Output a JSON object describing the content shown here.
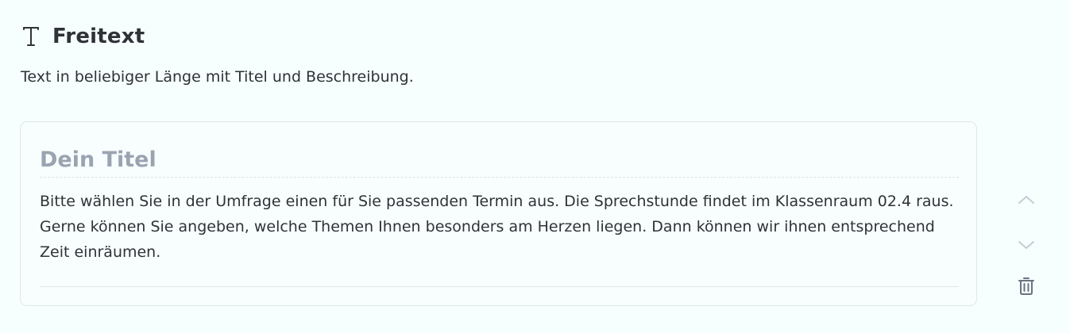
{
  "header": {
    "icon": "text-type-icon",
    "title": "Freitext",
    "description": "Text in beliebiger Länge mit Titel und Beschreibung."
  },
  "card": {
    "title_placeholder": "Dein Titel",
    "title_value": "",
    "body_value": "Bitte wählen Sie in der Umfrage einen für Sie passenden Termin aus. Die Sprechstunde findet im Klassenraum 02.4 raus.\nGerne können Sie angeben, welche Themen Ihnen besonders am Herzen liegen. Dann können wir ihnen entsprechend Zeit einräumen."
  },
  "controls": {
    "move_up_icon": "chevron-up-icon",
    "move_down_icon": "chevron-down-icon",
    "delete_icon": "trash-icon"
  },
  "colors": {
    "background": "#f6fefe",
    "text": "#2f3237",
    "placeholder": "#9aa4b1",
    "border": "#dfe6ea",
    "icon_muted": "#c5ccd4",
    "icon_delete": "#6b7280"
  }
}
